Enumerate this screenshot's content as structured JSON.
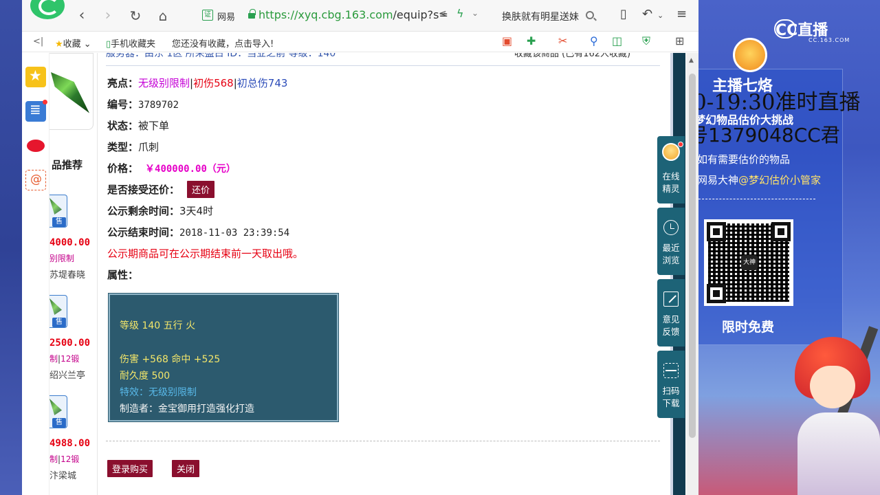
{
  "browser": {
    "site_badge": "证",
    "site_name": "网易",
    "url_main": "https://xyq.cbg.163.com",
    "url_rest": "/equip?s=",
    "search_text": "换肤就有明星送妹"
  },
  "bookmarks": {
    "sidebar_toggle": "<|",
    "favorites_label": "收藏",
    "mobile_label": "手机收藏夹",
    "empty_hint": "您还没有收藏，点击导入!"
  },
  "recommend": {
    "title": "品推荐",
    "sell_tag": "售",
    "items": [
      {
        "price": "4000.00",
        "tag": "别限制",
        "level": "",
        "seller": "苏堤春晓"
      },
      {
        "price": "2500.00",
        "tag": "制",
        "level": "12锻",
        "seller": "绍兴兰亭"
      },
      {
        "price": "4988.00",
        "tag": "制",
        "level": "12锻",
        "seller": "汴梁城"
      }
    ]
  },
  "detail": {
    "top_cut_left": "服务器：由东 1区    所来盛占    ID：当业之前  等级：140",
    "top_cut_right": "收藏该商品     (已有162人收藏)",
    "highlight_label": "亮点：",
    "highlights": [
      "无级别限制",
      "初伤568",
      "初总伤743"
    ],
    "serial_label": "编号：",
    "serial": "3789702",
    "status_label": "状态：",
    "status": "被下单",
    "type_label": "类型：",
    "type": "爪刺",
    "price_label": "价格：",
    "price": "￥400000.00（元）",
    "bargain_label": "是否接受还价：",
    "bargain_button": "还价",
    "remain_label": "公示剩余时间：",
    "remain": "3天4时",
    "end_label": "公示结束时间：",
    "end_time": "2018-11-03 23:39:54",
    "notice": "公示期商品可在公示期结束前一天取出哦。",
    "attr_label": "属性：",
    "attributes": {
      "level_line": "等级 140 五行 火",
      "damage_line": "伤害 +568 命中 +525",
      "durability_line": "耐久度 500",
      "effect_line": "特效：无级别限制",
      "maker_line": "制造者：金宝御用打造强化打造"
    },
    "buy_button": "登录购买",
    "close_button": "关闭"
  },
  "side_widget": {
    "online": [
      "在线",
      "精灵"
    ],
    "recent": [
      "最近",
      "浏览"
    ],
    "feedback": [
      "意见",
      "反馈"
    ],
    "scan": [
      "扫码",
      "下载"
    ]
  },
  "stream": {
    "cc_logo": "CC直播",
    "cc_sub": "CC.163.COM",
    "streamer": "主播七烙",
    "overlay_time": "0-19:30准时直播",
    "promo_title": "梦幻物品估价大挑战",
    "overlay_room": "号1379048CC君",
    "line1": "如有需要估价的物品",
    "line2_prefix": "网易大神",
    "line2_at": "@梦幻估价小管家",
    "qr_center": "大神",
    "free_label": "限时免费"
  }
}
